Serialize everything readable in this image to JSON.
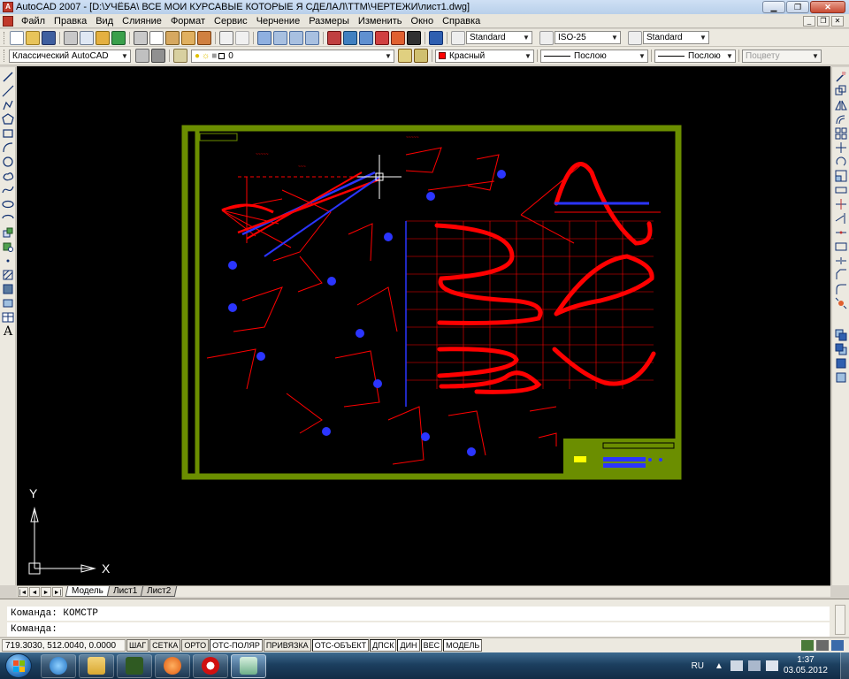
{
  "window": {
    "title": "AutoCAD 2007 - [D:\\УЧЁБА\\ ВСЕ МОИ КУРСАВЫЕ КОТОРЫЕ Я СДЕЛАЛ\\ТТМ\\ЧЕРТЕЖИ\\лист1.dwg]",
    "icon_letter": "A"
  },
  "menu": {
    "items": [
      "Файл",
      "Правка",
      "Вид",
      "Слияние",
      "Формат",
      "Сервис",
      "Черчение",
      "Размеры",
      "Изменить",
      "Окно",
      "Справка"
    ]
  },
  "toolbar1": {
    "text_style": "Standard",
    "dim_style": "ISO-25",
    "table_style": "Standard"
  },
  "toolbar2": {
    "workspace": "Классический AutoCAD",
    "layer": "0",
    "color": "Красный",
    "linetype": "Послою",
    "lineweight": "Послою",
    "plotstyle": "Поцвету"
  },
  "canvas": {
    "ucs_y_label": "Y",
    "ucs_x_label": "X",
    "frame_color": "#6b8e00",
    "drawing_color": "#ff0000",
    "accent_color": "#2b35ff"
  },
  "layout_tabs": {
    "nav": [
      "|◄",
      "◄",
      "►",
      "►|"
    ],
    "tabs": [
      "Модель",
      "Лист1",
      "Лист2"
    ],
    "active": "Модель"
  },
  "command": {
    "history": "Команда: КОМСТР",
    "prompt": "Команда:"
  },
  "status": {
    "coords": "719.3030, 512.0040, 0.0000",
    "buttons": [
      "ШАГ",
      "СЕТКА",
      "ОРТО",
      "ОТС-ПОЛЯР",
      "ПРИВЯЗКА",
      "ОТС-ОБЪЕКТ",
      "ДПСК",
      "ДИН",
      "ВЕС",
      "МОДЕЛЬ"
    ],
    "active_buttons": [
      "ОТС-ПОЛЯР",
      "ОТС-ОБЪЕКТ",
      "ДПСК",
      "ДИН",
      "ВЕС",
      "МОДЕЛЬ"
    ]
  },
  "taskbar": {
    "language": "RU",
    "time": "1:37",
    "date": "03.05.2012",
    "apps": [
      "internet-explorer",
      "file-explorer",
      "game",
      "media-player",
      "opera",
      "autocad"
    ]
  }
}
